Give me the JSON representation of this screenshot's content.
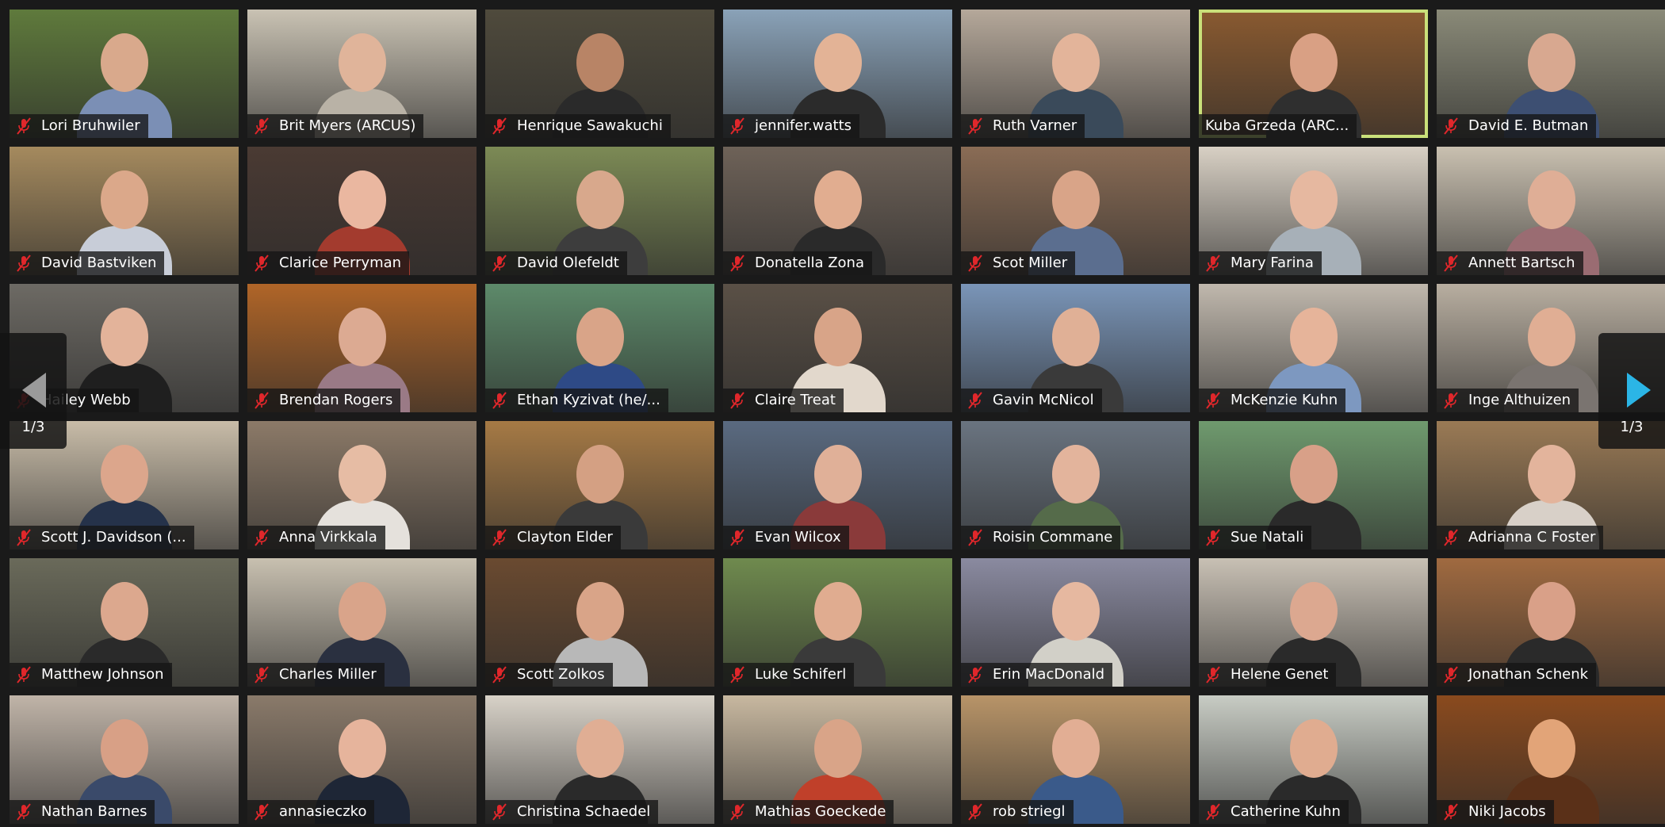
{
  "pagination": {
    "current_page": "1/3",
    "left_arrow": "previous-page",
    "right_arrow": "next-page",
    "accent": "#2bb5e6"
  },
  "active_speaker_border": "#c9e07a",
  "muted_icon_color": "#e0272b",
  "participants": [
    {
      "name": "Lori Bruhwiler",
      "muted": true,
      "bg": "#5f7a3c",
      "skin": "#d9a98c",
      "shirt": "#7b8fb5"
    },
    {
      "name": "Brit Myers (ARCUS)",
      "muted": true,
      "bg": "#c9c2b3",
      "skin": "#e0b49a",
      "shirt": "#b9b2a6"
    },
    {
      "name": "Henrique Sawakuchi",
      "muted": true,
      "bg": "#4f4a3c",
      "skin": "#b88466",
      "shirt": "#2a2a2a"
    },
    {
      "name": "jennifer.watts",
      "muted": true,
      "bg": "#8aa2b8",
      "skin": "#e3b396",
      "shirt": "#2b2b2b"
    },
    {
      "name": "Ruth Varner",
      "muted": true,
      "bg": "#b5a89a",
      "skin": "#e3b49a",
      "shirt": "#3a4a5a"
    },
    {
      "name": "Kuba Grzeda (ARC...",
      "muted": false,
      "active": true,
      "bg": "#8a5a30",
      "skin": "#d9a084",
      "shirt": "#2f2f2f"
    },
    {
      "name": "David E. Butman",
      "muted": true,
      "bg": "#8a8a78",
      "skin": "#d8a890",
      "shirt": "#3d4f72"
    },
    {
      "name": "David Bastviken",
      "muted": true,
      "bg": "#a58a5e",
      "skin": "#dba88a",
      "shirt": "#c8cdd8"
    },
    {
      "name": "Clarice Perryman",
      "muted": true,
      "bg": "#4a3a33",
      "skin": "#eab7a0",
      "shirt": "#a33b2e"
    },
    {
      "name": "David Olefeldt",
      "muted": true,
      "bg": "#7c8a55",
      "skin": "#d8a88c",
      "shirt": "#3d3d3d"
    },
    {
      "name": "Donatella Zona",
      "muted": true,
      "bg": "#6e6258",
      "skin": "#e1ad90",
      "shirt": "#2a2a2a"
    },
    {
      "name": "Scot Miller",
      "muted": true,
      "bg": "#8a6c55",
      "skin": "#d9a488",
      "shirt": "#5b6e8f"
    },
    {
      "name": "Mary Farina",
      "muted": true,
      "bg": "#d8d0c4",
      "skin": "#e6b8a0",
      "shirt": "#a7b0b8"
    },
    {
      "name": "Annett Bartsch",
      "muted": true,
      "bg": "#c9c0b0",
      "skin": "#dfae96",
      "shirt": "#9a6c72"
    },
    {
      "name": "Hailey Webb",
      "muted": true,
      "bg": "#6d6a64",
      "skin": "#e3b39a",
      "shirt": "#1f1f1f"
    },
    {
      "name": "Brendan Rogers",
      "muted": true,
      "bg": "#b06528",
      "skin": "#dcaa92",
      "shirt": "#9a7a86"
    },
    {
      "name": "Ethan Kyzivat (he/...",
      "muted": true,
      "bg": "#5d8a6a",
      "skin": "#d9a488",
      "shirt": "#2e4a86"
    },
    {
      "name": "Claire Treat",
      "muted": true,
      "bg": "#5a5046",
      "skin": "#d8a488",
      "shirt": "#e2d8cc"
    },
    {
      "name": "Gavin McNicol",
      "muted": true,
      "bg": "#7a95b8",
      "skin": "#e0b096",
      "shirt": "#3a3a3a"
    },
    {
      "name": "McKenzie Kuhn",
      "muted": true,
      "bg": "#c0b8ad",
      "skin": "#e6b49a",
      "shirt": "#7d98c0"
    },
    {
      "name": "Inge Althuizen",
      "muted": true,
      "bg": "#b8aea0",
      "skin": "#e0ae94",
      "shirt": "#7a7470"
    },
    {
      "name": "Scott J. Davidson (...",
      "muted": true,
      "bg": "#c8bca8",
      "skin": "#dca68c",
      "shirt": "#25324a"
    },
    {
      "name": "Anna Virkkala",
      "muted": true,
      "bg": "#8c7a68",
      "skin": "#e6bca4",
      "shirt": "#e5e1dc"
    },
    {
      "name": "Clayton Elder",
      "muted": true,
      "bg": "#a67a45",
      "skin": "#d4a083",
      "shirt": "#3a3a3a"
    },
    {
      "name": "Evan Wilcox",
      "muted": true,
      "bg": "#5a6a80",
      "skin": "#e0b098",
      "shirt": "#8a3a3a"
    },
    {
      "name": "Roisin Commane",
      "muted": true,
      "bg": "#6a7480",
      "skin": "#e3b49c",
      "shirt": "#556b4a"
    },
    {
      "name": "Sue Natali",
      "muted": true,
      "bg": "#6f9a6e",
      "skin": "#d8a088",
      "shirt": "#2a2a2a"
    },
    {
      "name": "Adrianna C Foster",
      "muted": true,
      "bg": "#9a7a55",
      "skin": "#e3b49c",
      "shirt": "#d8d0c8"
    },
    {
      "name": "Matthew Johnson",
      "muted": true,
      "bg": "#6a6a5a",
      "skin": "#dca88e",
      "shirt": "#2a2a2a"
    },
    {
      "name": "Charles Miller",
      "muted": true,
      "bg": "#c8c0b0",
      "skin": "#d9a48a",
      "shirt": "#2a3040"
    },
    {
      "name": "Scott Zolkos",
      "muted": true,
      "bg": "#6a4a30",
      "skin": "#d9a488",
      "shirt": "#b8b8b8"
    },
    {
      "name": "Luke Schiferl",
      "muted": true,
      "bg": "#6f8a4e",
      "skin": "#e0ac90",
      "shirt": "#3a3a3a"
    },
    {
      "name": "Erin MacDonald",
      "muted": true,
      "bg": "#8a8aa0",
      "skin": "#e6b8a0",
      "shirt": "#d2d0c8"
    },
    {
      "name": "Helene Genet",
      "muted": true,
      "bg": "#c8c0b4",
      "skin": "#dca890",
      "shirt": "#2a2a2a"
    },
    {
      "name": "Jonathan Schenk",
      "muted": true,
      "bg": "#a06a40",
      "skin": "#d9a088",
      "shirt": "#2a2a2a"
    },
    {
      "name": "Nathan Barnes",
      "muted": true,
      "bg": "#c0b4a8",
      "skin": "#d8a086",
      "shirt": "#3a4a6a"
    },
    {
      "name": "annasieczko",
      "muted": true,
      "bg": "#8a7a6a",
      "skin": "#e6b49c",
      "shirt": "#1e2636"
    },
    {
      "name": "Christina Schaedel",
      "muted": true,
      "bg": "#d8d2c8",
      "skin": "#e0ae94",
      "shirt": "#2a2a2a"
    },
    {
      "name": "Mathias Goeckede",
      "muted": true,
      "bg": "#c8b8a0",
      "skin": "#d9a488",
      "shirt": "#c0402a"
    },
    {
      "name": "rob striegl",
      "muted": true,
      "bg": "#b89468",
      "skin": "#e2ae94",
      "shirt": "#3a5a8a"
    },
    {
      "name": "Catherine Kuhn",
      "muted": true,
      "bg": "#c8ccc4",
      "skin": "#e0ac90",
      "shirt": "#2a2a2a"
    },
    {
      "name": "Niki Jacobs",
      "muted": true,
      "bg": "#8a4a1e",
      "skin": "#e2a478",
      "shirt": "#5a3018"
    }
  ]
}
